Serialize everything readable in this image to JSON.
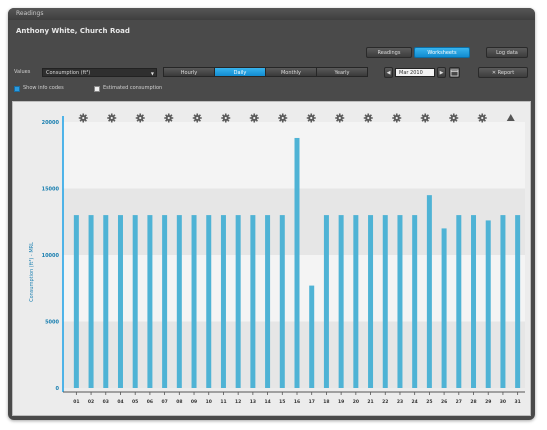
{
  "window": {
    "title": "Readings"
  },
  "customer_label": "Anthony White, Church Road",
  "header_buttons": {
    "readings": "Readings",
    "worksheets": "Worksheets",
    "log_data": "Log data"
  },
  "filters": {
    "values_label": "Values",
    "values_select": "Consumption (ft³)",
    "tabs": [
      {
        "label": "Hourly",
        "active": false
      },
      {
        "label": "Daily",
        "active": true
      },
      {
        "label": "Monthly",
        "active": false
      },
      {
        "label": "Yearly",
        "active": false
      }
    ],
    "period_value": "Mar 2010",
    "report_button": "Report"
  },
  "options": {
    "show_info_codes": {
      "label": "Show info codes",
      "checked": true
    },
    "estimated_consumption": {
      "label": "Estimated consumption",
      "checked": false
    }
  },
  "icons": {
    "calendar": "calendar-icon",
    "prev": "arrow-left-icon",
    "next": "arrow-right-icon",
    "info": "info-code-icon"
  },
  "colors": {
    "accent": "#1aa0e6",
    "bar": "#4fb3d5",
    "background": "#4a4a4a",
    "plot_band_a": "#e6e6e6",
    "plot_band_b": "#f4f4f4"
  },
  "chart_data": {
    "type": "bar",
    "title": "",
    "xlabel": "",
    "ylabel": "Consumption (ft³) - MRL",
    "ylim": [
      0,
      20000
    ],
    "y_ticks": [
      "0",
      "5000",
      "10000",
      "15000",
      "20000"
    ],
    "y_tick_values": [
      0,
      5000,
      10000,
      15000,
      20000
    ],
    "categories": [
      "01",
      "02",
      "03",
      "04",
      "05",
      "06",
      "07",
      "08",
      "09",
      "10",
      "11",
      "12",
      "13",
      "14",
      "15",
      "16",
      "17",
      "18",
      "19",
      "20",
      "21",
      "22",
      "23",
      "24",
      "25",
      "26",
      "27",
      "28",
      "29",
      "30",
      "31"
    ],
    "values": [
      13000,
      13000,
      13000,
      13000,
      13000,
      13000,
      13000,
      13000,
      13000,
      13000,
      13000,
      13000,
      13000,
      13000,
      13000,
      18800,
      7700,
      13000,
      13000,
      13000,
      13000,
      13000,
      13000,
      13000,
      14500,
      12000,
      13000,
      13000,
      12600,
      13000,
      13000
    ],
    "info_markers": [
      "gear",
      "gear",
      "gear",
      "gear",
      "gear",
      "gear",
      "gear",
      "gear",
      "gear",
      "gear",
      "gear",
      "gear",
      "gear",
      "gear",
      "gear",
      "triangle"
    ],
    "grid": false,
    "legend": "none"
  }
}
